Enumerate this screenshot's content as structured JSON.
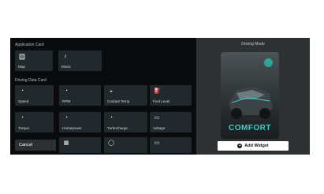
{
  "left": {
    "application_card_label": "Application Card",
    "driving_data_card_label": "Driving Data Card",
    "app_tiles": [
      {
        "label": "Map",
        "icon": "map-icon"
      },
      {
        "label": "Music",
        "icon": "music-icon"
      }
    ],
    "data_tiles_row1": [
      {
        "label": "Speed",
        "icon": "speedometer-icon"
      },
      {
        "label": "RPM",
        "icon": "rpm-gauge-icon"
      },
      {
        "label": "Coolant Temp",
        "icon": "coolant-icon"
      },
      {
        "label": "Fuel Level",
        "icon": "fuel-icon"
      }
    ],
    "data_tiles_row2": [
      {
        "label": "Torque",
        "icon": "torque-icon"
      },
      {
        "label": "Horsepower",
        "icon": "horsepower-icon"
      },
      {
        "label": "Turbocharge",
        "icon": "turbo-icon"
      },
      {
        "label": "Voltage",
        "icon": "voltage-icon"
      }
    ],
    "data_tiles_row3": [
      {
        "label": "",
        "icon": "grid-icon"
      },
      {
        "label": "",
        "icon": "gauge-icon"
      },
      {
        "label": "",
        "icon": "engine-icon"
      }
    ],
    "cancel_label": "Cancel"
  },
  "right": {
    "title": "Driving Mode",
    "card_word": "COMFORT",
    "add_widget_label": "Add Widget",
    "page_indicator": {
      "count": 2,
      "active": 0
    }
  },
  "colors": {
    "accent": "#32d2c6",
    "panel": "#0a0b0c",
    "tile": "#22292c"
  }
}
